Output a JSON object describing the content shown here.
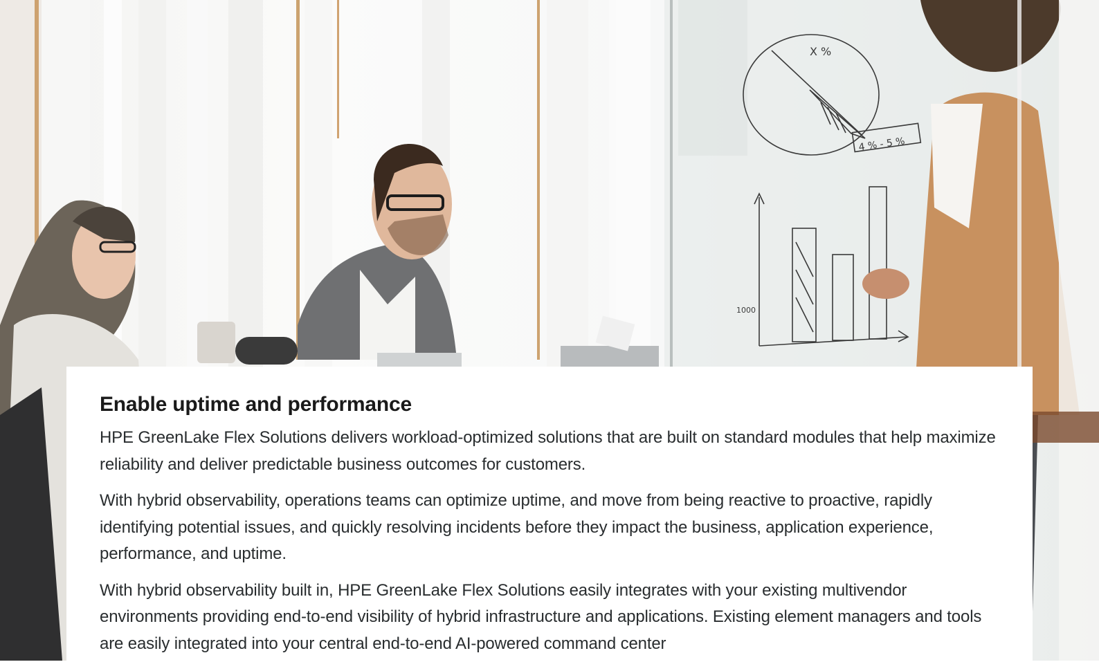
{
  "hero": {
    "image_description_icon": "meeting-photo",
    "whiteboard_pie_top_label": "X %",
    "whiteboard_pie_side_label": "4 % - 5 %",
    "whiteboard_axis_label": "1000"
  },
  "section": {
    "heading": "Enable uptime and performance",
    "paragraphs": [
      "HPE GreenLake Flex Solutions delivers workload-optimized solutions that are built on standard modules that help maximize reliability and deliver predictable business outcomes for customers.",
      "With hybrid observability, operations teams can optimize uptime, and move from being reactive to proactive, rapidly identifying potential issues, and quickly resolving incidents before they impact the business, application experience, performance, and uptime.",
      "With hybrid observability built in, HPE GreenLake Flex Solutions easily integrates with your existing multivendor environments providing end-to-end visibility of hybrid infrastructure and applications. Existing element managers and tools are easily integrated into your central end-to-end AI-powered command center"
    ]
  },
  "colors": {
    "heading": "#1a1a1a",
    "body_text": "#292d2f",
    "card_bg": "#ffffff"
  }
}
